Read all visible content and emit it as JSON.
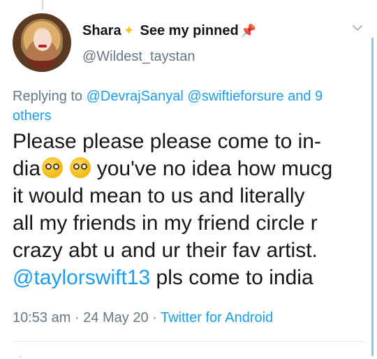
{
  "author": {
    "name": "Shara",
    "name_suffix": "See my pinned",
    "handle": "@Wildest_taystan",
    "avatar_icon": "profile-photo"
  },
  "reply": {
    "prefix": "Replying to ",
    "mentions": "@DevrajSanyal @swiftieforsure",
    "conjunction": " and ",
    "others": "9 others"
  },
  "tweet": {
    "line1": "Please please please come to in-",
    "line2_start": "dia",
    "line2_end": " you've no idea how mucg",
    "line3": "it would mean to us and literally",
    "line4": "all my friends in my friend circle r",
    "line5": "crazy abt u and ur their fav artist.",
    "mention": "@taylorswift13",
    "line6_end": " pls come to india"
  },
  "meta": {
    "time": "10:53 am",
    "separator1": " · ",
    "date": "24 May 20",
    "separator2": " · ",
    "source": "Twitter for Android"
  },
  "colors": {
    "accent": "#1d9bf0",
    "secondary_text": "#657786",
    "primary_text": "#14171a"
  }
}
